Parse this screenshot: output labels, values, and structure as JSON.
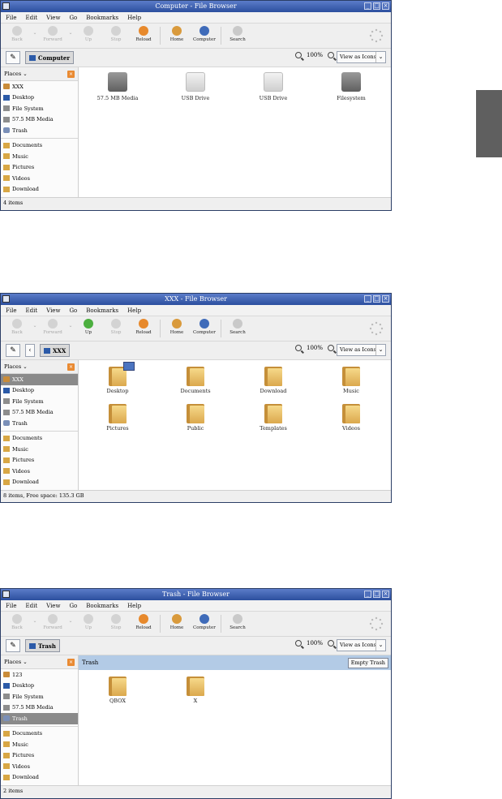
{
  "side_tab_color": "#5f5f5f",
  "common": {
    "menu": [
      "File",
      "Edit",
      "View",
      "Go",
      "Bookmarks",
      "Help"
    ],
    "toolbar": {
      "back": "Back",
      "forward": "Forward",
      "up": "Up",
      "stop": "Stop",
      "reload": "Reload",
      "home": "Home",
      "computer": "Computer",
      "search": "Search"
    },
    "zoom": "100%",
    "view_mode": "View as Icons",
    "places_label": "Places"
  },
  "windows": [
    {
      "title": "Computer - File Browser",
      "up_enabled": false,
      "breadcrumb": "Computer",
      "has_back_crumb": false,
      "places": [
        {
          "label": "XXX",
          "icon": "home-icon",
          "selected": false
        },
        {
          "label": "Desktop",
          "icon": "desktop-icon",
          "selected": false
        },
        {
          "label": "File System",
          "icon": "drive-icon",
          "selected": false
        },
        {
          "label": "57.5 MB Media",
          "icon": "drive-icon",
          "selected": false
        },
        {
          "label": "Trash",
          "icon": "trash-icon",
          "selected": false
        }
      ],
      "bookmarks": [
        "Documents",
        "Music",
        "Pictures",
        "Videos",
        "Download"
      ],
      "items": [
        {
          "label": "57.5 MB Media",
          "kind": "drive-grey"
        },
        {
          "label": "USB Drive",
          "kind": "drive-white"
        },
        {
          "label": "USB Drive",
          "kind": "drive-white"
        },
        {
          "label": "Filesystem",
          "kind": "drive-grey"
        }
      ],
      "status": "4 items"
    },
    {
      "title": "XXX - File Browser",
      "up_enabled": true,
      "breadcrumb": "XXX",
      "has_back_crumb": true,
      "places": [
        {
          "label": "XXX",
          "icon": "home-icon",
          "selected": true
        },
        {
          "label": "Desktop",
          "icon": "desktop-icon",
          "selected": false
        },
        {
          "label": "File System",
          "icon": "drive-icon",
          "selected": false
        },
        {
          "label": "57.5 MB Media",
          "icon": "drive-icon",
          "selected": false
        },
        {
          "label": "Trash",
          "icon": "trash-icon",
          "selected": false
        }
      ],
      "bookmarks": [
        "Documents",
        "Music",
        "Pictures",
        "Videos",
        "Download"
      ],
      "items": [
        {
          "label": "Desktop",
          "kind": "folder-desktop"
        },
        {
          "label": "Documents",
          "kind": "folder"
        },
        {
          "label": "Download",
          "kind": "folder"
        },
        {
          "label": "Music",
          "kind": "folder"
        },
        {
          "label": "Pictures",
          "kind": "folder"
        },
        {
          "label": "Public",
          "kind": "folder"
        },
        {
          "label": "Templates",
          "kind": "folder"
        },
        {
          "label": "Videos",
          "kind": "folder"
        }
      ],
      "status": "8 items, Free space: 135.3 GB"
    },
    {
      "title": "Trash - File Browser",
      "up_enabled": false,
      "breadcrumb": "Trash",
      "has_back_crumb": false,
      "trash_bar": {
        "label": "Trash",
        "button": "Empty Trash"
      },
      "places": [
        {
          "label": "123",
          "icon": "home-icon",
          "selected": false
        },
        {
          "label": "Desktop",
          "icon": "desktop-icon",
          "selected": false
        },
        {
          "label": "File System",
          "icon": "drive-icon",
          "selected": false
        },
        {
          "label": "57.5 MB Media",
          "icon": "drive-icon",
          "selected": false
        },
        {
          "label": "Trash",
          "icon": "trash-icon",
          "selected": true
        }
      ],
      "bookmarks": [
        "Documents",
        "Music",
        "Pictures",
        "Videos",
        "Download"
      ],
      "items": [
        {
          "label": "QBOX",
          "kind": "folder"
        },
        {
          "label": "X",
          "kind": "folder"
        }
      ],
      "status": "2 items"
    }
  ]
}
